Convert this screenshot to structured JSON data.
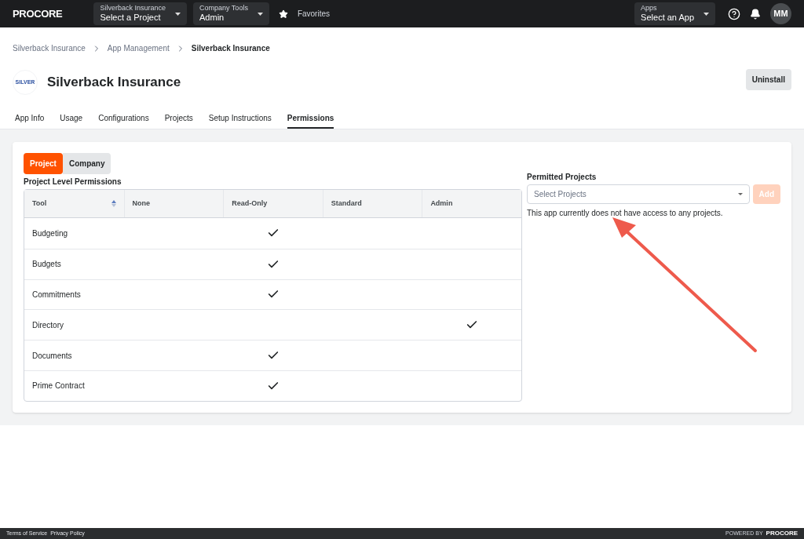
{
  "topbar": {
    "logo": "PROCORE",
    "project_picker": {
      "label": "Silverback Insurance",
      "value": "Select a Project"
    },
    "tools_picker": {
      "label": "Company Tools",
      "value": "Admin"
    },
    "favorites": "Favorites",
    "apps_picker": {
      "label": "Apps",
      "value": "Select an App"
    },
    "avatar": "MM"
  },
  "breadcrumbs": [
    "Silverback Insurance",
    "App Management",
    "Silverback Insurance"
  ],
  "app": {
    "logo_text": "SILVER",
    "title": "Silverback Insurance",
    "uninstall": "Uninstall"
  },
  "tabs": [
    {
      "label": "App Info",
      "selected": false
    },
    {
      "label": "Usage",
      "selected": false
    },
    {
      "label": "Configurations",
      "selected": false
    },
    {
      "label": "Projects",
      "selected": false
    },
    {
      "label": "Setup Instructions",
      "selected": false
    },
    {
      "label": "Permissions",
      "selected": true
    }
  ],
  "level_toggle": [
    {
      "label": "Project",
      "selected": true
    },
    {
      "label": "Company",
      "selected": false
    }
  ],
  "permissions": {
    "title": "Project Level Permissions",
    "columns": [
      "Tool",
      "None",
      "Read-Only",
      "Standard",
      "Admin"
    ],
    "rows": [
      {
        "tool": "Budgeting",
        "cells": [
          {
            "checked": false
          },
          {
            "checked": true
          },
          {
            "checked": false
          },
          {
            "checked": false
          }
        ]
      },
      {
        "tool": "Budgets",
        "cells": [
          {
            "checked": false
          },
          {
            "checked": true
          },
          {
            "checked": false
          },
          {
            "checked": false
          }
        ]
      },
      {
        "tool": "Commitments",
        "cells": [
          {
            "checked": false
          },
          {
            "checked": true
          },
          {
            "checked": false
          },
          {
            "checked": false
          }
        ]
      },
      {
        "tool": "Directory",
        "cells": [
          {
            "checked": false
          },
          {
            "checked": false
          },
          {
            "checked": false
          },
          {
            "checked": true
          }
        ]
      },
      {
        "tool": "Documents",
        "cells": [
          {
            "checked": false
          },
          {
            "checked": true
          },
          {
            "checked": false
          },
          {
            "checked": false
          }
        ]
      },
      {
        "tool": "Prime Contract",
        "cells": [
          {
            "checked": false
          },
          {
            "checked": true
          },
          {
            "checked": false
          },
          {
            "checked": false
          }
        ]
      }
    ]
  },
  "permitted": {
    "title": "Permitted Projects",
    "placeholder": "Select Projects",
    "add": "Add",
    "add_disabled": true,
    "message": "This app currently does not have access to any projects."
  },
  "footer": {
    "links": [
      "Terms of Service",
      "Privacy Policy"
    ],
    "powered_by": "POWERED BY",
    "logo": "PROCORE"
  }
}
